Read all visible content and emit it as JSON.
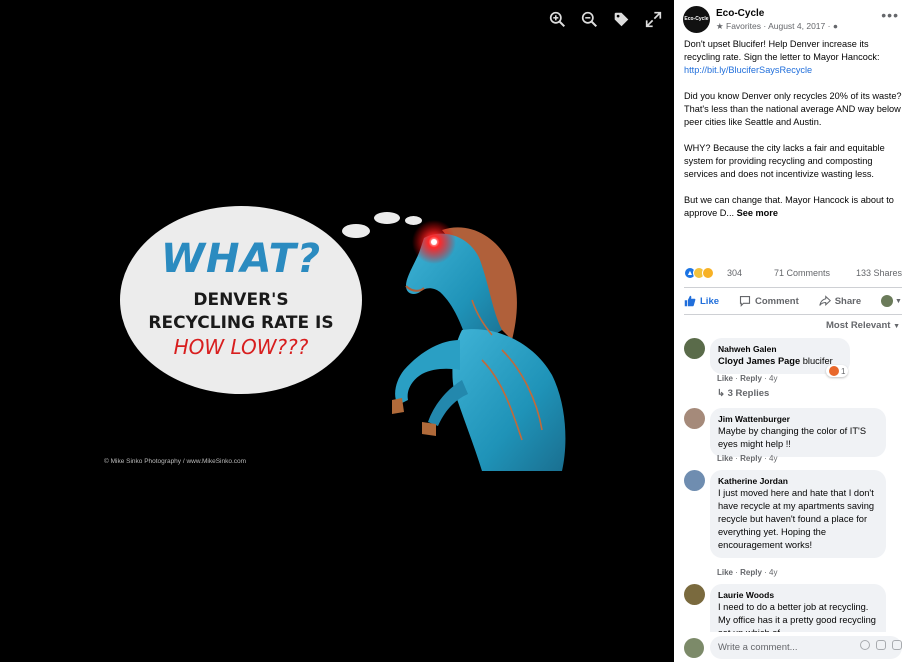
{
  "viewer": {
    "tools": [
      {
        "icon": "zoom-in-icon"
      },
      {
        "icon": "zoom-out-icon"
      },
      {
        "icon": "tag-icon"
      },
      {
        "icon": "fullscreen-icon"
      }
    ],
    "photo": {
      "bubble_title": "WHAT?",
      "bubble_line1": "DENVER'S",
      "bubble_line2": "RECYCLING RATE IS",
      "bubble_line3": "HOW LOW???",
      "credit": "© Mike Sinko Photography / www.MikeSinko.com"
    }
  },
  "post": {
    "avatar_text": "Eco-Cycle",
    "page_name": "Eco-Cycle",
    "favorites": "Favorites",
    "date": "August 4, 2017",
    "paragraph1": "Don't upset Blucifer! Help Denver increase its recycling rate. Sign the letter to Mayor Hancock: ",
    "link": "http://bit.ly/BluciferSaysRecycle",
    "paragraph2": "Did you know Denver only recycles 20% of its waste? That's less than the national average AND way below peer cities like Seattle and Austin.",
    "paragraph3": "WHY? Because the city lacks a fair and equitable system for providing recycling and composting services and does not incentivize wasting less.",
    "paragraph4": "But we can change that. Mayor Hancock is about to approve D...",
    "see_more": "See more"
  },
  "stats": {
    "reactions": "304",
    "comments": "71 Comments",
    "shares": "133 Shares"
  },
  "actions": {
    "like": "Like",
    "comment": "Comment",
    "share": "Share"
  },
  "sort_label": "Most Relevant",
  "comments": [
    {
      "name": "Nahweh Galen",
      "tag": "Cloyd James Page",
      "text": " blucifer",
      "like": "Like",
      "reply": "Reply",
      "time": "4y",
      "reaction_count": "1",
      "replies": "3 Replies"
    },
    {
      "name": "Jim Wattenburger",
      "text": "Maybe by changing the color of IT'S eyes might help !!",
      "like": "Like",
      "reply": "Reply",
      "time": "4y"
    },
    {
      "name": "Katherine Jordan",
      "text": "I just moved here and hate that I don't have recycle at my apartments saving recycle but haven't found a place for everything yet. Hoping the encouragement works!",
      "like": "Like",
      "reply": "Reply",
      "time": "4y"
    },
    {
      "name": "Laurie Woods",
      "text": "I need to do a better job at recycling. My office has it a pretty good recycling set up which of"
    }
  ],
  "composer": {
    "placeholder": "Write a comment..."
  },
  "colors": {
    "link": "#216fdb",
    "bubble_blue": "#2b8bc0",
    "bubble_red": "#d81e1e",
    "horse_blue": "#1f93b8"
  }
}
